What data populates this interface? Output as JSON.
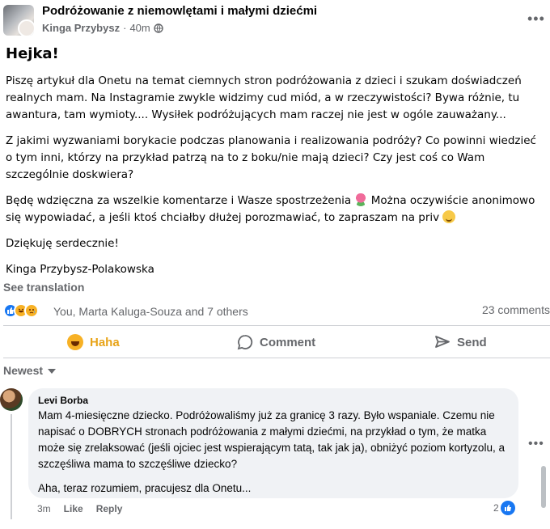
{
  "post": {
    "group_name": "Podróżowanie z niemowlętami i małymi dziećmi",
    "author": "Kinga Przybysz",
    "separator": "·",
    "time": "40m",
    "greeting": "Hejka!",
    "paragraphs": [
      "Piszę artykuł dla Onetu na temat ciemnych stron podróżowania z dzieci i szukam doświadczeń realnych mam. Na Instagramie zwykle widzimy cud miód, a w rzeczywistości? Bywa różnie, tu awantura, tam wymioty.... Wysiłek podróżujących mam raczej nie jest w ogóle zauważany...",
      "Z jakimi wyzwaniami borykacie podczas planowania i realizowania podróży? Co powinni wiedzieć o tym inni, którzy na przykład patrzą na to z boku/nie mają dzieci? Czy jest coś co Wam szczególnie doskwiera?"
    ],
    "p3_part1": "Będę wdzięczna za wszelkie komentarze i Wasze spostrzeżenia",
    "p3_part2": " Można oczywiście anonimowo się wypowiadać, a jeśli ktoś chciałby dłużej porozmawiać, to zapraszam na priv",
    "thanks": "Dziękuję serdecznie!",
    "signature": "Kinga Przybysz-Polakowska",
    "see_translation": "See translation",
    "reactions_text": "You, Marta Kaluga-Souza and 7 others",
    "comment_count": "23 comments"
  },
  "actions": {
    "haha": "Haha",
    "comment": "Comment",
    "send": "Send"
  },
  "sort_label": "Newest",
  "comment": {
    "author": "Levi Borba",
    "paragraph1": "Mam 4-miesięczne dziecko. Podróżowaliśmy już za granicę 3 razy. Było wspaniale. Czemu nie napisać o DOBRYCH stronach podróżowania z małymi dziećmi, na przykład o tym, że matka może się zrelaksować (jeśli ojciec jest wspierającym tatą, tak jak ja), obniżyć poziom kortyzolu, a szczęśliwa mama to szczęśliwe dziecko?",
    "paragraph2": "Aha, teraz rozumiem, pracujesz dla Onetu...",
    "time": "3m",
    "like": "Like",
    "reply": "Reply",
    "like_count": "2"
  },
  "colors": {
    "secondary_text": "#65676b",
    "like_blue": "#1877f2",
    "haha_yellow": "#e8a419",
    "bubble_bg": "#f0f2f5"
  },
  "icons": [
    "globe-icon",
    "more-icon",
    "tulip-emoji",
    "smile-emoji",
    "like-reaction-icon",
    "haha-reaction-icon",
    "sad-reaction-icon",
    "haha-icon",
    "comment-icon",
    "send-icon",
    "caret-down-icon",
    "like-badge-icon"
  ]
}
